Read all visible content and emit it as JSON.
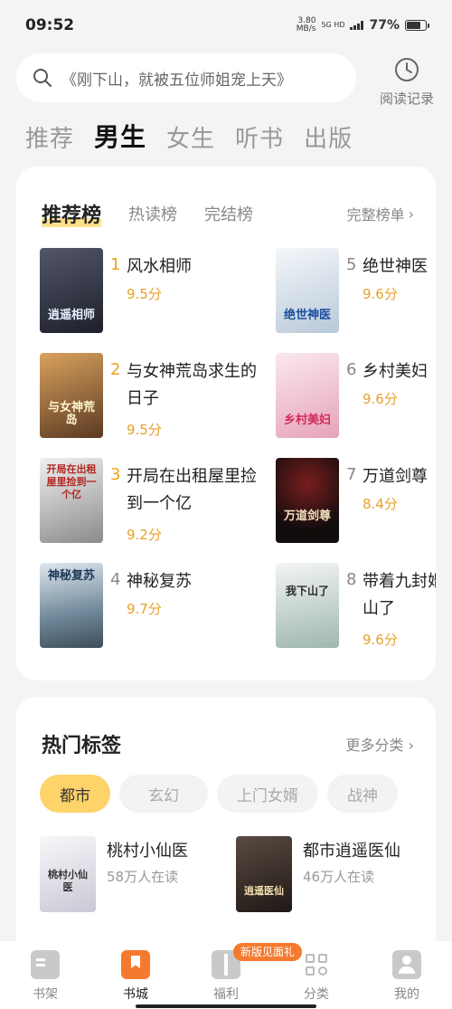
{
  "status": {
    "time": "09:52",
    "speed_value": "3.80",
    "speed_unit": "MB/s",
    "network": "5G HD",
    "battery": "77%"
  },
  "search": {
    "placeholder": "《刚下山，就被五位师姐宠上天》",
    "history_label": "阅读记录"
  },
  "top_tabs": [
    {
      "label": "推荐",
      "active": false
    },
    {
      "label": "男生",
      "active": true
    },
    {
      "label": "女生",
      "active": false
    },
    {
      "label": "听书",
      "active": false
    },
    {
      "label": "出版",
      "active": false
    }
  ],
  "ranking": {
    "tabs": [
      {
        "label": "推荐榜",
        "active": true
      },
      {
        "label": "热读榜",
        "active": false
      },
      {
        "label": "完结榜",
        "active": false
      }
    ],
    "full_list_label": "完整榜单",
    "books": [
      {
        "rank": "1",
        "title": "风水相师",
        "score": "9.5分",
        "cover_text": "逍遥相师",
        "cover_color": "#2b2f3d"
      },
      {
        "rank": "2",
        "title": "与女神荒岛求生的日子",
        "score": "9.5分",
        "cover_text": "与女神荒岛",
        "cover_color": "#a06a3a"
      },
      {
        "rank": "3",
        "title": "开局在出租屋里捡到一个亿",
        "score": "9.2分",
        "cover_text": "开局在出租屋里捡到一个亿",
        "cover_color": "#cfcfcf"
      },
      {
        "rank": "4",
        "title": "神秘复苏",
        "score": "9.7分",
        "cover_text": "神秘复苏",
        "cover_color": "#9ab0c0"
      },
      {
        "rank": "5",
        "title": "绝世神医",
        "score": "9.6分",
        "cover_text": "绝世神医",
        "cover_color": "#e8eef4"
      },
      {
        "rank": "6",
        "title": "乡村美妇",
        "score": "9.6分",
        "cover_text": "乡村美妇",
        "cover_color": "#f3d3dc"
      },
      {
        "rank": "7",
        "title": "万道剑尊",
        "score": "8.4分",
        "cover_text": "万道剑尊",
        "cover_color": "#1a1414"
      },
      {
        "rank": "8",
        "title": "带着九封婚书我下山了",
        "score": "9.6分",
        "cover_text": "我下山了",
        "cover_color": "#d9e2df"
      }
    ]
  },
  "tags": {
    "title": "热门标签",
    "more_label": "更多分类",
    "chips": [
      {
        "label": "都市",
        "active": true
      },
      {
        "label": "玄幻",
        "active": false
      },
      {
        "label": "上门女婿",
        "active": false
      },
      {
        "label": "战神",
        "active": false
      }
    ],
    "books": [
      {
        "title": "桃村小仙医",
        "readers": "58万人在读",
        "cover_color": "#e4e4ea",
        "cover_text": "桃村小仙医"
      },
      {
        "title": "都市逍遥医仙",
        "readers": "46万人在读",
        "cover_color": "#3a2f2a",
        "cover_text": "逍遥医仙"
      }
    ]
  },
  "bottom_nav": [
    {
      "label": "书架",
      "icon": "bookshelf-icon",
      "active": false
    },
    {
      "label": "书城",
      "icon": "bookstore-icon",
      "active": true
    },
    {
      "label": "福利",
      "icon": "gift-icon",
      "active": false
    },
    {
      "label": "分类",
      "icon": "category-icon",
      "active": false
    },
    {
      "label": "我的",
      "icon": "profile-icon",
      "active": false
    }
  ],
  "promo_badge": "新版见面礼",
  "colors": {
    "accent": "#f0a020",
    "score": "#e8a12a",
    "chip_active": "#fdd36a",
    "nav_active": "#f57a2e"
  }
}
